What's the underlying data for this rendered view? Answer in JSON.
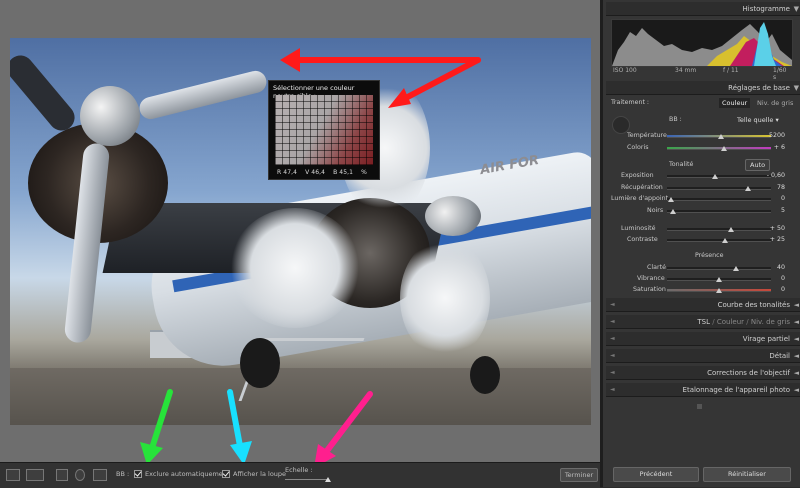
{
  "colors": {
    "arrow_red": "#ff1a1a",
    "arrow_green": "#27e33a",
    "arrow_cyan": "#18e0ff",
    "arrow_pink": "#ff1f8e"
  },
  "photo": {
    "fuselage_text": "AIR FOR"
  },
  "picker": {
    "title": "Sélectionner une couleur neutre cible :",
    "values": [
      "R 47,4",
      "V 46,4",
      "B 45,1",
      "%"
    ]
  },
  "toolbar": {
    "wb_label": "BB :",
    "auto_dismiss_label": "Exclure automatiquement",
    "show_loupe_label": "Afficher la loupe",
    "scale_label": "Echelle :",
    "done_label": "Terminer"
  },
  "panel": {
    "histogram": {
      "title": "Histogramme",
      "iso": "ISO 100",
      "focal": "34 mm",
      "aperture": "f / 11",
      "shutter": "1/60 s"
    },
    "basic": {
      "title": "Réglages de base",
      "treatment_label": "Traitement :",
      "treatment_color": "Couleur",
      "treatment_bw": "Niv. de gris",
      "wb_label": "BB :",
      "wb_value": "Telle quelle",
      "temp_label": "Température",
      "temp_value": "5200",
      "tint_label": "Coloris",
      "tint_value": "+ 6",
      "tone_label": "Tonalité",
      "auto_label": "Auto",
      "exposure_label": "Exposition",
      "exposure_value": "- 0,60",
      "recovery_label": "Récupération",
      "recovery_value": "78",
      "fill_label": "Lumière d'appoint",
      "fill_value": "0",
      "blacks_label": "Noirs",
      "blacks_value": "5",
      "brightness_label": "Luminosité",
      "brightness_value": "+ 50",
      "contrast_label": "Contraste",
      "contrast_value": "+ 25",
      "presence_label": "Présence",
      "clarity_label": "Clarté",
      "clarity_value": "40",
      "vibrance_label": "Vibrance",
      "vibrance_value": "0",
      "saturation_label": "Saturation",
      "saturation_value": "0"
    },
    "tone_curve_title": "Courbe des tonalités",
    "hsl": {
      "tsl": "TSL",
      "color": "Couleur",
      "gray": "Niv. de gris"
    },
    "split_toning_title": "Virage partiel",
    "detail_title": "Détail",
    "lens_title": "Corrections de l'objectif",
    "calibration_title": "Etalonnage de l'appareil photo",
    "prev_button": "Précédent",
    "reset_button": "Réinitialiser"
  },
  "sliders": {
    "temperature": 0.52,
    "tint": 0.55,
    "exposure": 0.46,
    "recovery": 0.78,
    "fill_light": 0.04,
    "blacks": 0.06,
    "brightness": 0.62,
    "contrast": 0.56,
    "clarity": 0.66,
    "vibrance": 0.5,
    "saturation": 0.5
  }
}
